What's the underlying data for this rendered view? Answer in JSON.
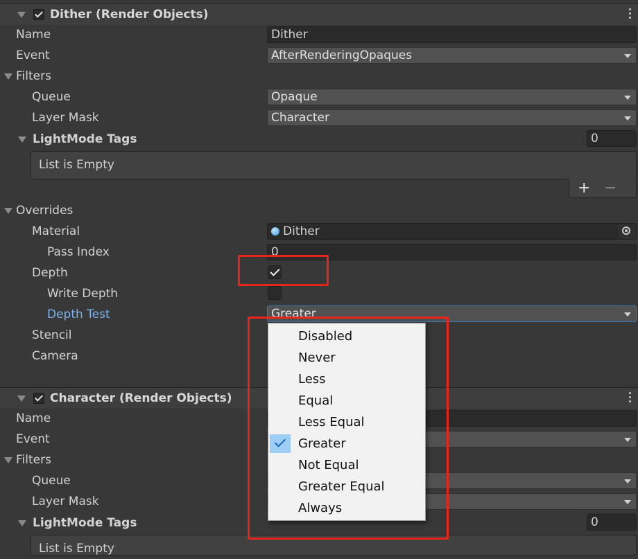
{
  "component1": {
    "title": "Dither (Render Objects)",
    "enabled": true,
    "name_label": "Name",
    "name_value": "Dither",
    "event_label": "Event",
    "event_value": "AfterRenderingOpaques",
    "filters_label": "Filters",
    "queue_label": "Queue",
    "queue_value": "Opaque",
    "layer_mask_label": "Layer Mask",
    "layer_mask_value": "Character",
    "lightmode_label": "LightMode Tags",
    "lightmode_count": "0",
    "list_empty": "List is Empty",
    "add_symbol": "+",
    "remove_symbol": "−",
    "overrides_label": "Overrides",
    "material_label": "Material",
    "material_value": "Dither",
    "pass_index_label": "Pass Index",
    "pass_index_value": "0",
    "depth_label": "Depth",
    "depth_checked": true,
    "write_depth_label": "Write Depth",
    "write_depth_checked": false,
    "depth_test_label": "Depth Test",
    "depth_test_value": "Greater",
    "stencil_label": "Stencil",
    "camera_label": "Camera"
  },
  "component2": {
    "title": "Character (Render Objects)",
    "enabled": true,
    "name_label": "Name",
    "event_label": "Event",
    "filters_label": "Filters",
    "queue_label": "Queue",
    "layer_mask_label": "Layer Mask",
    "lightmode_label": "LightMode Tags",
    "lightmode_count": "0",
    "list_empty": "List is Empty"
  },
  "dropdown_menu": {
    "options": [
      "Disabled",
      "Never",
      "Less",
      "Equal",
      "Less Equal",
      "Greater",
      "Not Equal",
      "Greater Equal",
      "Always"
    ],
    "selected": "Greater"
  },
  "colors": {
    "background": "#383838",
    "highlight_label": "#7bb4f0",
    "annotation_red": "#e8241c",
    "menu_selection": "#9ecef4"
  }
}
